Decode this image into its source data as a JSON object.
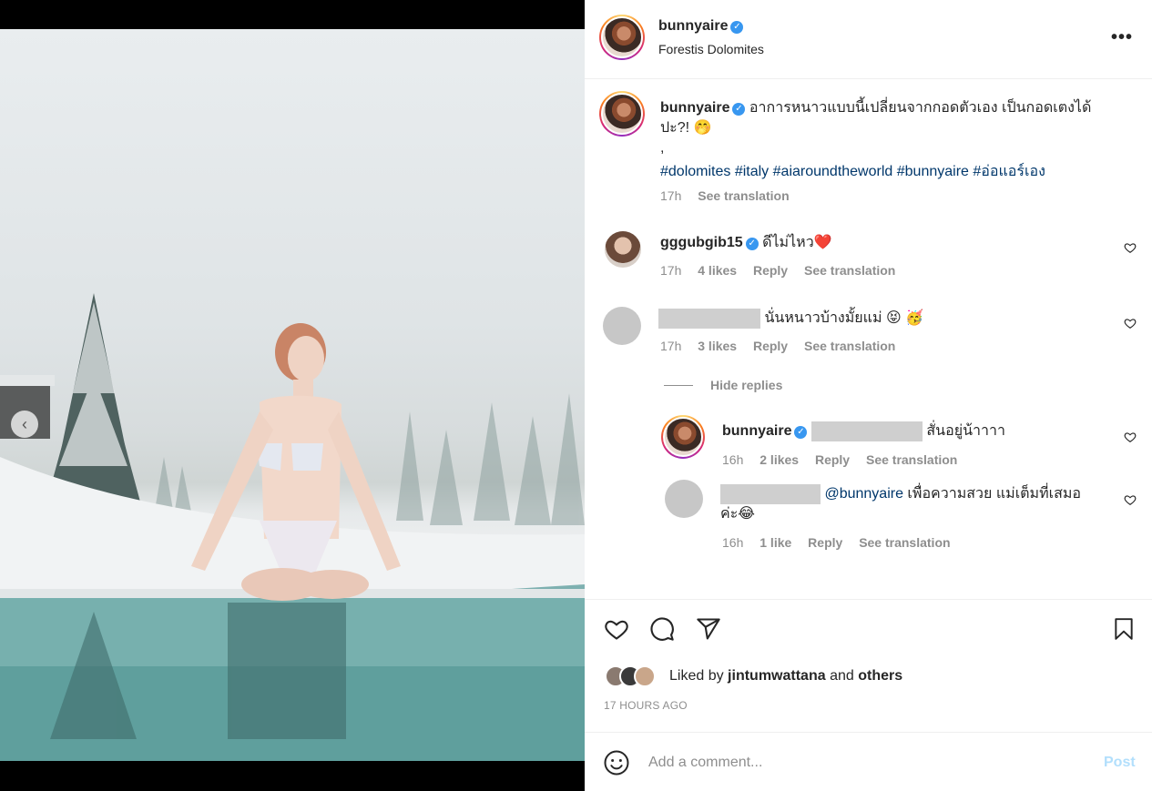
{
  "post": {
    "username": "bunnyaire",
    "location": "Forestis Dolomites",
    "caption": "อาการหนาวแบบนี้เปลี่ยนจากกอดตัวเอง เป็นกอดเตงได้",
    "caption_line2": "ปะ?!",
    "caption_emoji": "🤭",
    "caption_dot": ",",
    "hashtags": [
      "#dolomites",
      "#italy",
      "#aiaroundtheworld",
      "#bunnyaire",
      "#อ่อแอร์เอง"
    ],
    "caption_time": "17h",
    "see_translation": "See translation",
    "liked_by_prefix": "Liked by",
    "liked_by_user": "jintumwattana",
    "liked_by_and": "and",
    "liked_by_others": "others",
    "posted_ago": "17 HOURS AGO",
    "add_comment_placeholder": "Add a comment...",
    "post_button": "Post"
  },
  "comments": [
    {
      "username": "gggubgib15",
      "text": "ดีไม่ไหว",
      "emoji": "❤️",
      "time": "17h",
      "likes": "4 likes",
      "reply": "Reply",
      "see_translation": "See translation"
    },
    {
      "text": "นั่นหนาวบ้างมั้ยแม่",
      "emoji": "😝 🥳",
      "time": "17h",
      "likes": "3 likes",
      "reply": "Reply",
      "see_translation": "See translation",
      "hide_replies": "Hide replies",
      "replies": [
        {
          "username": "bunnyaire",
          "text": "สั่นอยู่น้าาาา",
          "time": "16h",
          "likes": "2 likes",
          "reply": "Reply",
          "see_translation": "See translation"
        },
        {
          "mention": "@bunnyaire",
          "text": "เพื่อความสวย แม่เต็มที่เสมอ",
          "text_line2": "ค่ะ",
          "emoji": "😂",
          "time": "16h",
          "likes": "1 like",
          "reply": "Reply",
          "see_translation": "See translation"
        }
      ]
    }
  ],
  "colors": {
    "link": "#00376b",
    "verified": "#3897f0",
    "muted": "#8e8e8e",
    "post_button": "#b2dffc"
  }
}
